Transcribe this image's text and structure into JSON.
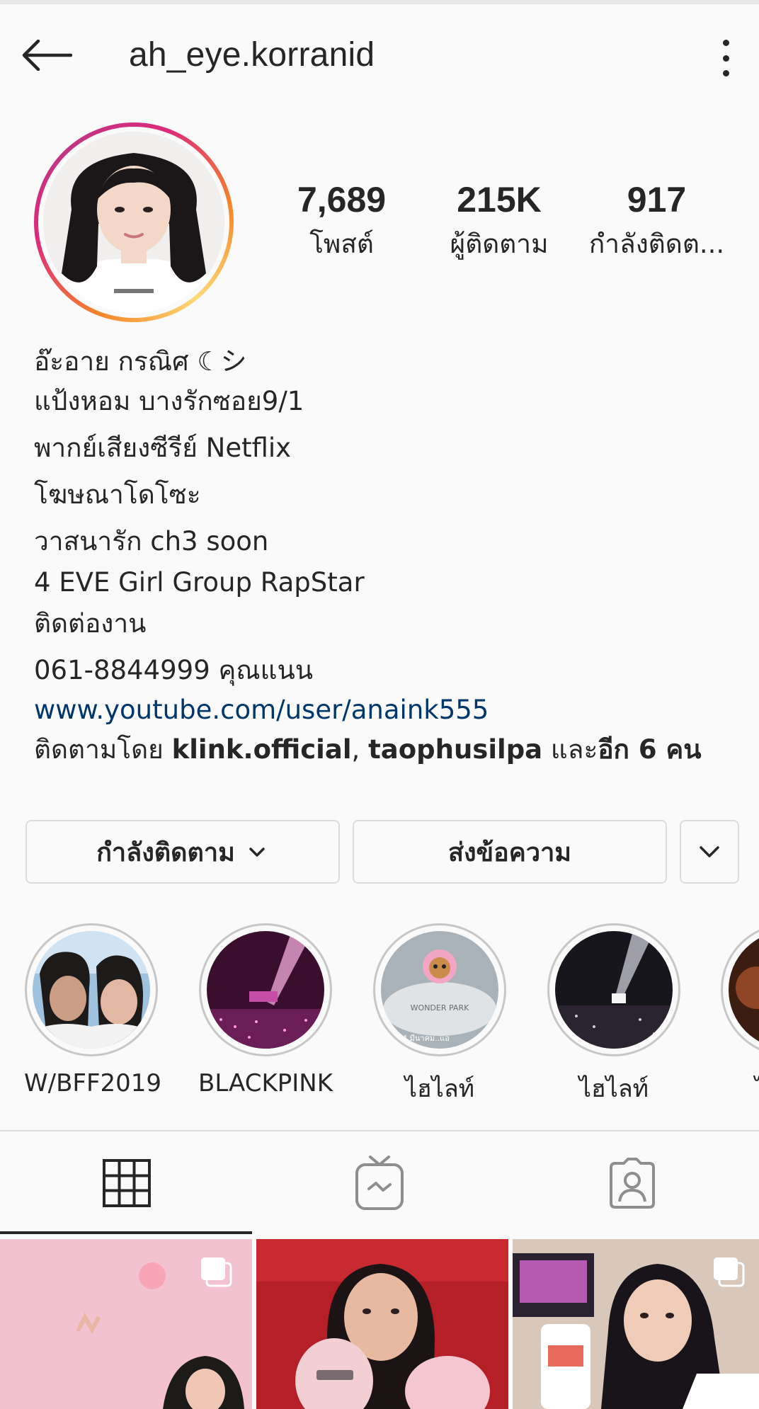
{
  "header": {
    "username": "ah_eye.korranid"
  },
  "stats": [
    {
      "value": "7,689",
      "label": "โพสต์"
    },
    {
      "value": "215K",
      "label": "ผู้ติดตาม"
    },
    {
      "value": "917",
      "label": "กำลังติดต..."
    }
  ],
  "bio": {
    "lines": [
      "อ๊ะอาย กรณิศ ☾シ",
      "แป้งหอม บางรักซอย9/1",
      "พากย์เสียงซีรีย์ Netflix",
      "โฆษณาโดโซะ",
      "วาสนารัก ch3 soon",
      "4 EVE Girl Group RapStar",
      "ติดต่องาน",
      "061-8844999 คุณแนน"
    ],
    "link": "www.youtube.com/user/anaink555",
    "followed_by_prefix": "ติดตามโดย ",
    "followed_by_user1": "klink.official",
    "followed_by_sep": ", ",
    "followed_by_user2": "taophusilpa",
    "followed_by_and": " และ",
    "followed_by_more": "อีก 6 คน"
  },
  "buttons": {
    "following_label": "กำลังติดตาม",
    "message_label": "ส่งข้อความ"
  },
  "highlights": [
    {
      "label": "W/BFF2019"
    },
    {
      "label": "BLACKPINK"
    },
    {
      "label": "ไฮไลท์"
    },
    {
      "label": "ไฮไลท์"
    },
    {
      "label": "ไ"
    }
  ],
  "highlight_thumb_text": {
    "wonder_park": "WONDER PARK",
    "date": "14 มีนาคม..แอ"
  },
  "tabs": [
    {
      "icon": "grid-icon",
      "active": true
    },
    {
      "icon": "igtv-icon",
      "active": false
    },
    {
      "icon": "tagged-icon",
      "active": false
    }
  ],
  "colors": {
    "text": "#262626",
    "link": "#00376b",
    "border": "#dbdbdb",
    "background": "#fafafa",
    "story_ring_start": "#f58529",
    "story_ring_end": "#c13584"
  }
}
